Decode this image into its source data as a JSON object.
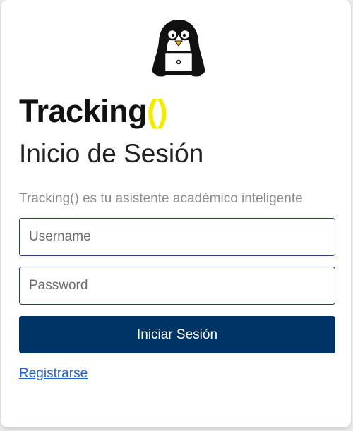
{
  "brand": {
    "name": "Tracking",
    "parens": "()"
  },
  "title": "Inicio de Sesión",
  "subtitle": "Tracking() es tu asistente académico inteligente",
  "form": {
    "username_placeholder": "Username",
    "password_placeholder": "Password",
    "submit_label": "Iniciar Sesión"
  },
  "register_link": "Registrarse",
  "colors": {
    "primary": "#003366",
    "brand_accent": "#f2ea00",
    "link": "#1f5fd6"
  },
  "icons": {
    "logo": "penguin-with-glasses-laptop-icon"
  }
}
